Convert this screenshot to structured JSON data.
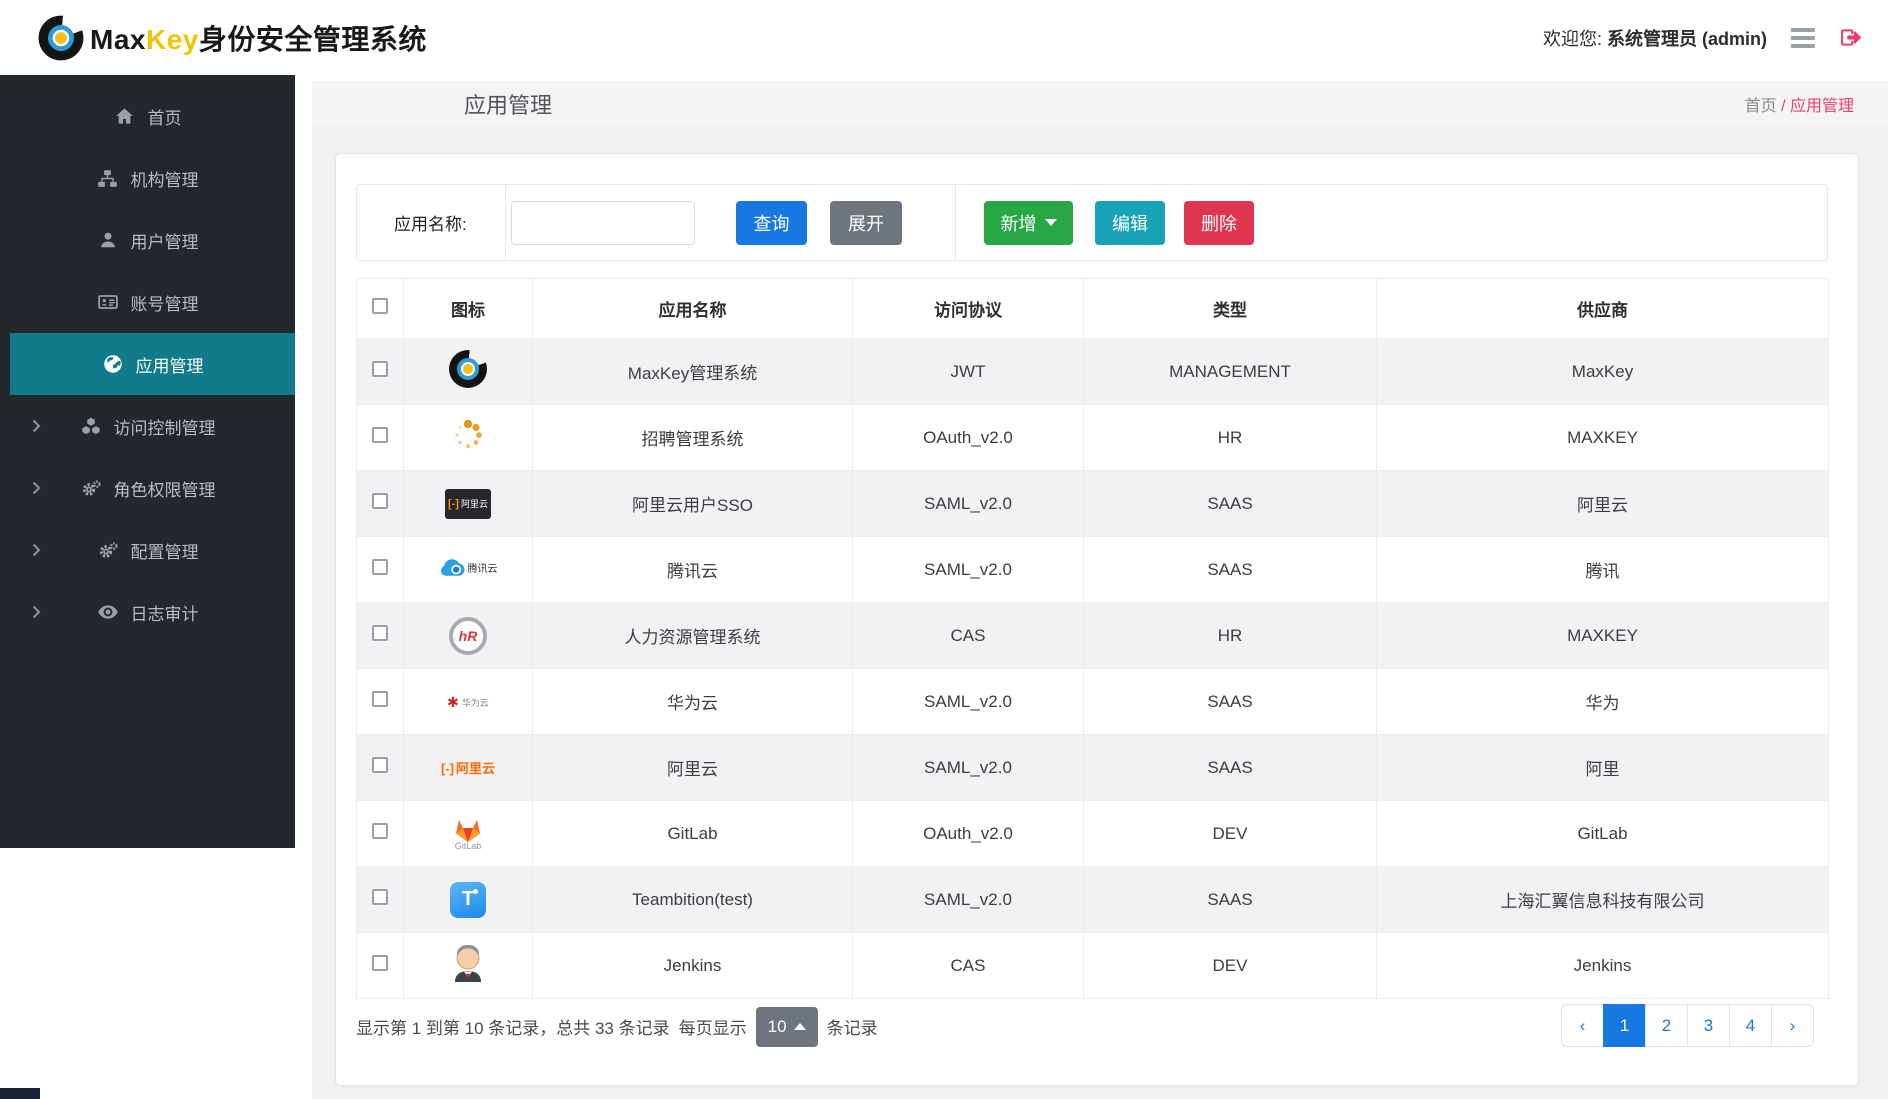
{
  "header": {
    "brand_max": "Max",
    "brand_key": "Key",
    "brand_suffix": "身份安全管理系统",
    "welcome_prefix": "欢迎您:",
    "user": "系统管理员 (admin)"
  },
  "sidebar": {
    "items": [
      {
        "key": "home",
        "label": "首页",
        "icon": "home-icon",
        "active": false,
        "expandable": false
      },
      {
        "key": "org",
        "label": "机构管理",
        "icon": "sitemap-icon",
        "active": false,
        "expandable": false
      },
      {
        "key": "user",
        "label": "用户管理",
        "icon": "user-icon",
        "active": false,
        "expandable": false
      },
      {
        "key": "account",
        "label": "账号管理",
        "icon": "idcard-icon",
        "active": false,
        "expandable": false
      },
      {
        "key": "app",
        "label": "应用管理",
        "icon": "globe-icon",
        "active": true,
        "expandable": false
      },
      {
        "key": "access",
        "label": "访问控制管理",
        "icon": "cubes-icon",
        "active": false,
        "expandable": true
      },
      {
        "key": "role",
        "label": "角色权限管理",
        "icon": "gears-icon",
        "active": false,
        "expandable": true
      },
      {
        "key": "config",
        "label": "配置管理",
        "icon": "gears-icon",
        "active": false,
        "expandable": true
      },
      {
        "key": "audit",
        "label": "日志审计",
        "icon": "eye-icon",
        "active": false,
        "expandable": true
      }
    ]
  },
  "page": {
    "title": "应用管理",
    "breadcrumb_home": "首页",
    "breadcrumb_sep": "/",
    "breadcrumb_current": "应用管理"
  },
  "toolbar": {
    "search_label": "应用名称:",
    "search_value": "",
    "query_label": "查询",
    "expand_label": "展开",
    "add_label": "新增",
    "edit_label": "编辑",
    "delete_label": "删除"
  },
  "table": {
    "headers": [
      "图标",
      "应用名称",
      "访问协议",
      "类型",
      "供应商"
    ],
    "rows": [
      {
        "name": "MaxKey管理系统",
        "protocol": "JWT",
        "type": "MANAGEMENT",
        "vendor": "MaxKey",
        "icon": "maxkey-app-icon"
      },
      {
        "name": "招聘管理系统",
        "protocol": "OAuth_v2.0",
        "type": "HR",
        "vendor": "MAXKEY",
        "icon": "dots-app-icon"
      },
      {
        "name": "阿里云用户SSO",
        "protocol": "SAML_v2.0",
        "type": "SAAS",
        "vendor": "阿里云",
        "icon": "aliyun-dark-icon"
      },
      {
        "name": "腾讯云",
        "protocol": "SAML_v2.0",
        "type": "SAAS",
        "vendor": "腾讯",
        "icon": "tencent-cloud-icon"
      },
      {
        "name": "人力资源管理系统",
        "protocol": "CAS",
        "type": "HR",
        "vendor": "MAXKEY",
        "icon": "hr-app-icon"
      },
      {
        "name": "华为云",
        "protocol": "SAML_v2.0",
        "type": "SAAS",
        "vendor": "华为",
        "icon": "huawei-cloud-icon"
      },
      {
        "name": "阿里云",
        "protocol": "SAML_v2.0",
        "type": "SAAS",
        "vendor": "阿里",
        "icon": "aliyun-light-icon"
      },
      {
        "name": "GitLab",
        "protocol": "OAuth_v2.0",
        "type": "DEV",
        "vendor": "GitLab",
        "icon": "gitlab-icon"
      },
      {
        "name": "Teambition(test)",
        "protocol": "SAML_v2.0",
        "type": "SAAS",
        "vendor": "上海汇翼信息科技有限公司",
        "icon": "teambition-icon"
      },
      {
        "name": "Jenkins",
        "protocol": "CAS",
        "type": "DEV",
        "vendor": "Jenkins",
        "icon": "jenkins-icon"
      }
    ]
  },
  "pagination": {
    "summary": "显示第 1 到第 10 条记录，总共 33 条记录",
    "per_page_label": "每页显示",
    "page_size": "10",
    "unit": "条记录",
    "prev": "‹",
    "next": "›",
    "pages": [
      "1",
      "2",
      "3",
      "4"
    ],
    "active_page": "1"
  },
  "colors": {
    "primary_blue": "#1778e2",
    "success_green": "#28a745",
    "info_teal": "#17a2b8",
    "danger_red": "#df3550",
    "secondary_gray": "#6e757d",
    "accent_pink": "#ee3d6e",
    "sidebar_active_teal": "#117a8b",
    "sidebar_bg": "#23282c",
    "brand_yellow": "#f5c400"
  }
}
